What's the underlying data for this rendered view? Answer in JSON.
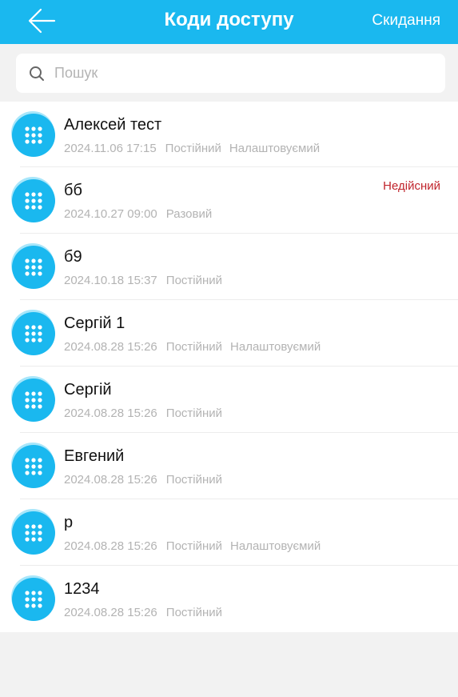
{
  "header": {
    "title": "Коди доступу",
    "reset_label": "Скидання",
    "back_icon": "arrow-left-icon",
    "background": "#1ab8ef"
  },
  "search": {
    "placeholder": "Пошук",
    "value": "",
    "icon": "search-icon"
  },
  "items": [
    {
      "name": "Алексей тест",
      "datetime": "2024.11.06 17:15",
      "type": "Постійний",
      "extra": "Налаштовуємий",
      "status": ""
    },
    {
      "name": "бб",
      "datetime": "2024.10.27 09:00",
      "type": "Разовий",
      "extra": "",
      "status": "Недійсний"
    },
    {
      "name": "б9",
      "datetime": "2024.10.18 15:37",
      "type": "Постійний",
      "extra": "",
      "status": ""
    },
    {
      "name": "Сергій 1",
      "datetime": "2024.08.28 15:26",
      "type": "Постійний",
      "extra": "Налаштовуємий",
      "status": ""
    },
    {
      "name": "Сергій",
      "datetime": "2024.08.28 15:26",
      "type": "Постійний",
      "extra": "",
      "status": ""
    },
    {
      "name": "Евгений",
      "datetime": "2024.08.28 15:26",
      "type": "Постійний",
      "extra": "",
      "status": ""
    },
    {
      "name": "р",
      "datetime": "2024.08.28 15:26",
      "type": "Постійний",
      "extra": "Налаштовуємий",
      "status": ""
    },
    {
      "name": "1234",
      "datetime": "2024.08.28 15:26",
      "type": "Постійний",
      "extra": "",
      "status": ""
    }
  ],
  "colors": {
    "accent": "#1ab8ef",
    "invalid_status": "#c0242c",
    "secondary_text": "#b3b3b3"
  },
  "item_icon": "keypad-icon"
}
